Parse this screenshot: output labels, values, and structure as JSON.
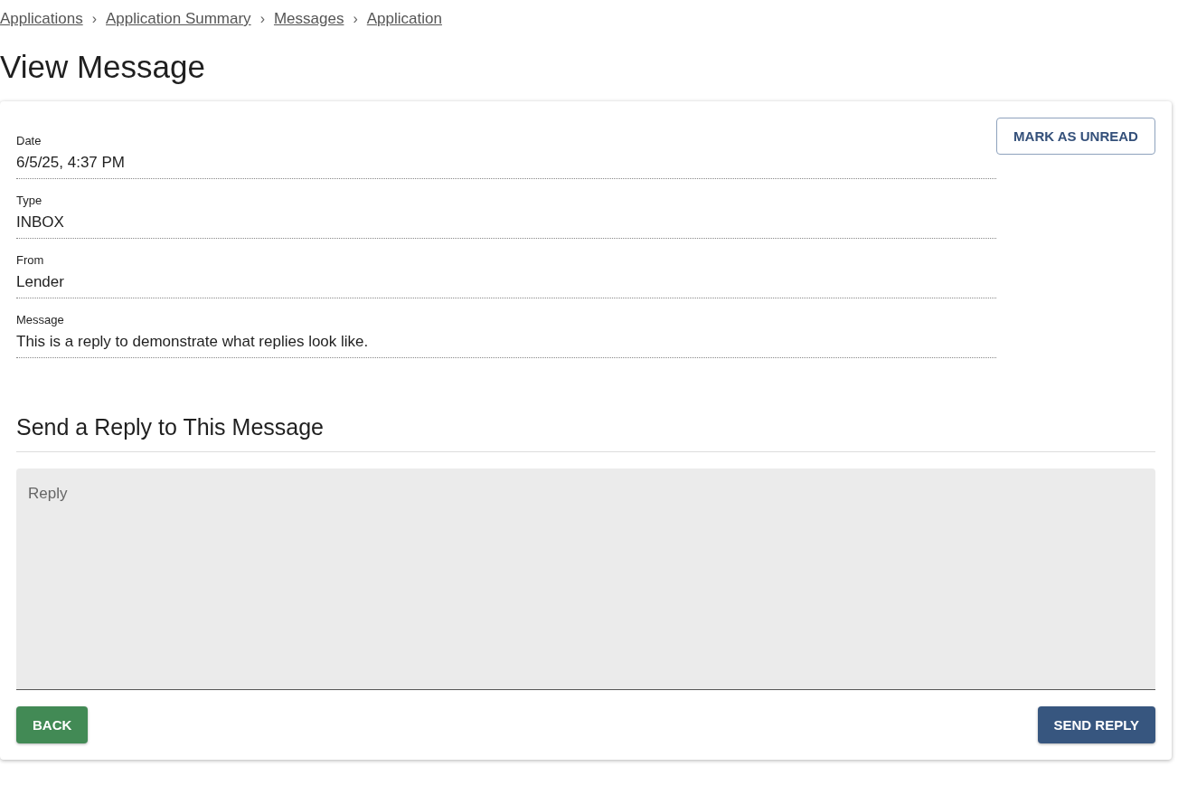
{
  "breadcrumbs": [
    {
      "label": "Applications"
    },
    {
      "label": "Application Summary"
    },
    {
      "label": "Messages"
    },
    {
      "label": "Application"
    }
  ],
  "breadcrumb_separator": "›",
  "title": "View Message",
  "mark_button": "MARK AS UNREAD",
  "fields": [
    {
      "label": "Date",
      "value": "6/5/25, 4:37 PM"
    },
    {
      "label": "Type",
      "value": "INBOX"
    },
    {
      "label": "From",
      "value": "Lender"
    },
    {
      "label": "Message",
      "value": "This is a reply to demonstrate what replies look like."
    }
  ],
  "reply_heading": "Send a Reply to This Message",
  "reply": {
    "placeholder": "Reply"
  },
  "back_button": "BACK",
  "send_button": "SEND REPLY"
}
